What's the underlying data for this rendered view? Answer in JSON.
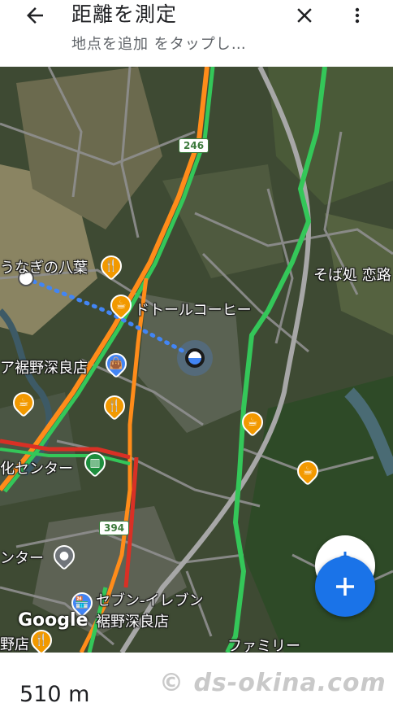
{
  "header": {
    "title": "距離を測定",
    "subtitle": "地点を追加 をタップし…"
  },
  "map": {
    "labels": {
      "unagi": "うなぎの八葉",
      "doutor": "ドトールコーヒー",
      "susono_shop": "ア裾野深良店",
      "center1": "化センター",
      "center2": "ンター",
      "soba": "そば処 恋路",
      "seven": "セブン-イレブン",
      "seven_branch": "裾野深良店",
      "family": "ファミリー",
      "bottom_left": "野店"
    },
    "routes": [
      "246",
      "394"
    ],
    "attribution": "Google"
  },
  "measurement": {
    "distance": "510 m"
  },
  "watermark": "© ds-okina.com",
  "colors": {
    "accent": "#1a73e8",
    "traffic_green": "#34c759",
    "traffic_orange": "#ff8c1a",
    "traffic_red": "#d93025"
  }
}
